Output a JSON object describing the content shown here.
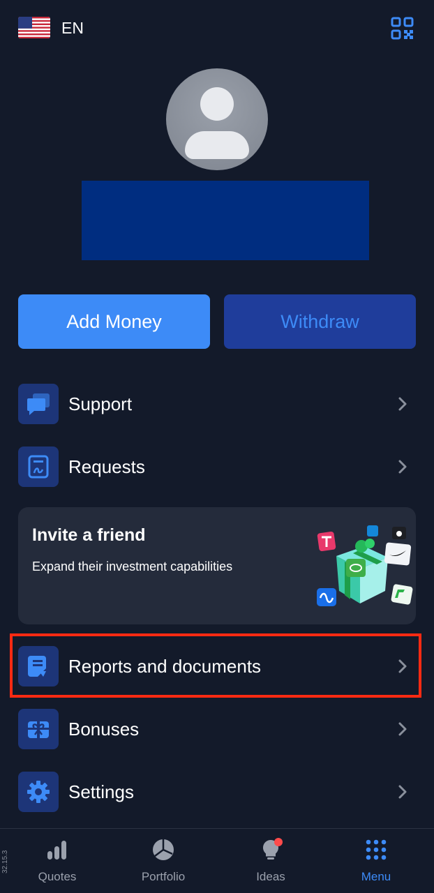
{
  "header": {
    "language": "EN",
    "flag_icon": "us-flag-icon",
    "qr_icon": "qr-code-icon"
  },
  "profile": {
    "avatar_icon": "user-avatar-icon",
    "name_redacted": true
  },
  "actions": {
    "add_money": "Add Money",
    "withdraw": "Withdraw"
  },
  "menu": {
    "support": "Support",
    "requests": "Requests",
    "reports": "Reports and documents",
    "bonuses": "Bonuses",
    "settings": "Settings"
  },
  "invite": {
    "title": "Invite a friend",
    "subtitle": "Expand their investment capabilities"
  },
  "app_version": "32.15.3",
  "bottom_nav": {
    "quotes": "Quotes",
    "portfolio": "Portfolio",
    "ideas": "Ideas",
    "menu": "Menu",
    "active": "Menu"
  },
  "colors": {
    "background": "#131a2a",
    "accent": "#3d8bf7",
    "icon_tile": "#1d3578",
    "highlight": "#ff2a12",
    "notification_dot": "#ff4b4b"
  }
}
